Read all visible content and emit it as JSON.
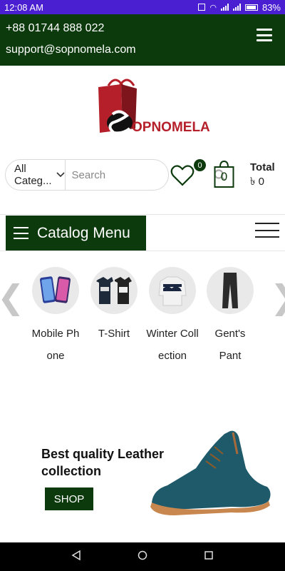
{
  "status_bar": {
    "time": "12:08 AM",
    "battery": "83%"
  },
  "topbar": {
    "phone": "+88 01744 888 022",
    "email": "support@sopnomela.com"
  },
  "logo": {
    "text": "OPNOMELA",
    "mark_letter": "S"
  },
  "search": {
    "category_label": "All Categ...",
    "placeholder": "Search"
  },
  "wishlist": {
    "count": "0"
  },
  "cart": {
    "count": "0",
    "total_label": "Total",
    "total_value": "৳ 0"
  },
  "catalog_menu": {
    "label": "Catalog Menu"
  },
  "categories": [
    {
      "name": "Mobile Phone"
    },
    {
      "name": "T-Shirt"
    },
    {
      "name": "Winter Collection"
    },
    {
      "name": "Gent's Pant"
    }
  ],
  "banner": {
    "title": "Best quality Leather collection",
    "button_label": "SHOP"
  },
  "colors": {
    "status_bar": "#4a1fd1",
    "brand_green": "#0c3a0c",
    "logo_red": "#b51f2a"
  }
}
